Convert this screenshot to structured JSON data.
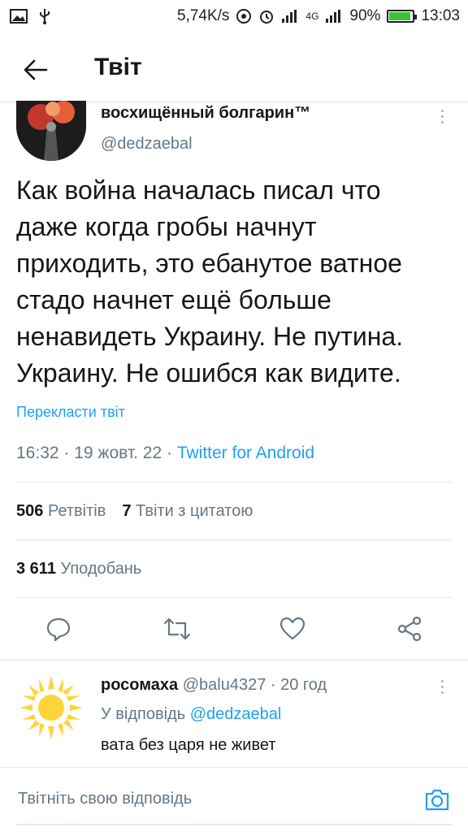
{
  "status_bar": {
    "speed": "5,74K/s",
    "network": "4G",
    "battery": "90%",
    "battery_level": 0.9,
    "time": "13:03",
    "icons": [
      "image-icon",
      "usb-icon",
      "wifi-hotspot-icon",
      "alarm-icon",
      "signal-icon",
      "battery-icon"
    ]
  },
  "header": {
    "title": "Твіт",
    "back_icon": "arrow-left-icon"
  },
  "tweet": {
    "display_name": "восхищённый болгарин™",
    "handle": "@dedzaebal",
    "text": "Как война началась писал что\nдаже когда гробы начнут\nприходить, это ебанутое ватное\nстадо начнет ещё больше\nненавидеть Украину. Не путина.\nУкраину. Не ошибся как видите.",
    "translate": "Перекласти твіт",
    "timestamp": "16:32 · 19 жовт. 22 · ",
    "source": "Twitter for Android",
    "retweets_count": "506",
    "retweets_label": "Ретвітів",
    "quotes_count": "7",
    "quotes_label": "Твіти з цитатою",
    "likes_count": "3 611",
    "likes_label": "Уподобань"
  },
  "actions": [
    {
      "name": "reply-icon"
    },
    {
      "name": "retweet-icon"
    },
    {
      "name": "like-icon"
    },
    {
      "name": "share-icon"
    }
  ],
  "reply": {
    "name": "росомаха",
    "handle": "@balu4327",
    "time": "· 20 год",
    "replying_to_label": "У відповідь",
    "replying_to_handle": "@dedzaebal",
    "text": "вата без царя не живет"
  },
  "compose": {
    "placeholder": "Твітніть свою відповідь",
    "camera_icon": "camera-icon"
  },
  "colors": {
    "accent": "#1da1f2",
    "text": "#14171a",
    "secondary": "#657786",
    "divider": "#e1e8ed",
    "sun": "#ffd43b"
  }
}
